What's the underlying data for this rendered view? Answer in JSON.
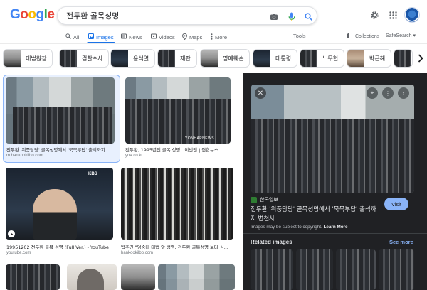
{
  "logo": {
    "letters": [
      {
        "ch": "G",
        "color": "#4285f4"
      },
      {
        "ch": "o",
        "color": "#ea4335"
      },
      {
        "ch": "o",
        "color": "#fbbc05"
      },
      {
        "ch": "g",
        "color": "#4285f4"
      },
      {
        "ch": "l",
        "color": "#34a853"
      },
      {
        "ch": "e",
        "color": "#ea4335"
      }
    ]
  },
  "search": {
    "query": "전두환 골목성명"
  },
  "tabs": {
    "all": "All",
    "images": "Images",
    "news": "News",
    "videos": "Videos",
    "maps": "Maps",
    "more": "More",
    "tools": "Tools",
    "collections": "Collections",
    "safesearch": "SafeSearch"
  },
  "chips": [
    {
      "label": "대법원장"
    },
    {
      "label": "검찰수사"
    },
    {
      "label": "윤석열"
    },
    {
      "label": "재판"
    },
    {
      "label": "명예훼손"
    },
    {
      "label": "대통령"
    },
    {
      "label": "노무현"
    },
    {
      "label": "박근혜"
    }
  ],
  "results": [
    {
      "caption": "전두환 '위풍당당' 골목성명에서 '묵묵부답' 출석까지 ...",
      "source": "m.hankookilbo.com"
    },
    {
      "caption": "전두환, 1995년엔 골목 성명.. 이번엔 | 연합뉴스",
      "source": "yna.co.kr",
      "watermark": "YONHAPNEWS"
    },
    {
      "caption": "19951202 전두환 골목 성명 (Full Ver.) - YouTube",
      "source": "youtube.com",
      "badge": "KBS"
    },
    {
      "caption": "박주민 \"엄숭태 대법 앞 성명, 전두환 골목성명 보다 심...",
      "source": "hankookilbo.com"
    }
  ],
  "panel": {
    "source_name": "한국일보",
    "title": "전두환 '위풍당당' 골목성명에서 '묵묵부답' 출석까지 변천사",
    "visit_label": "Visit",
    "copyright": "Images may be subject to copyright.",
    "learn_more": "Learn More",
    "related_label": "Related images",
    "see_more": "See more"
  },
  "colors": {
    "accent": "#1a73e8",
    "panel_bg": "#202124",
    "visit_bg": "#8ab4f8"
  }
}
